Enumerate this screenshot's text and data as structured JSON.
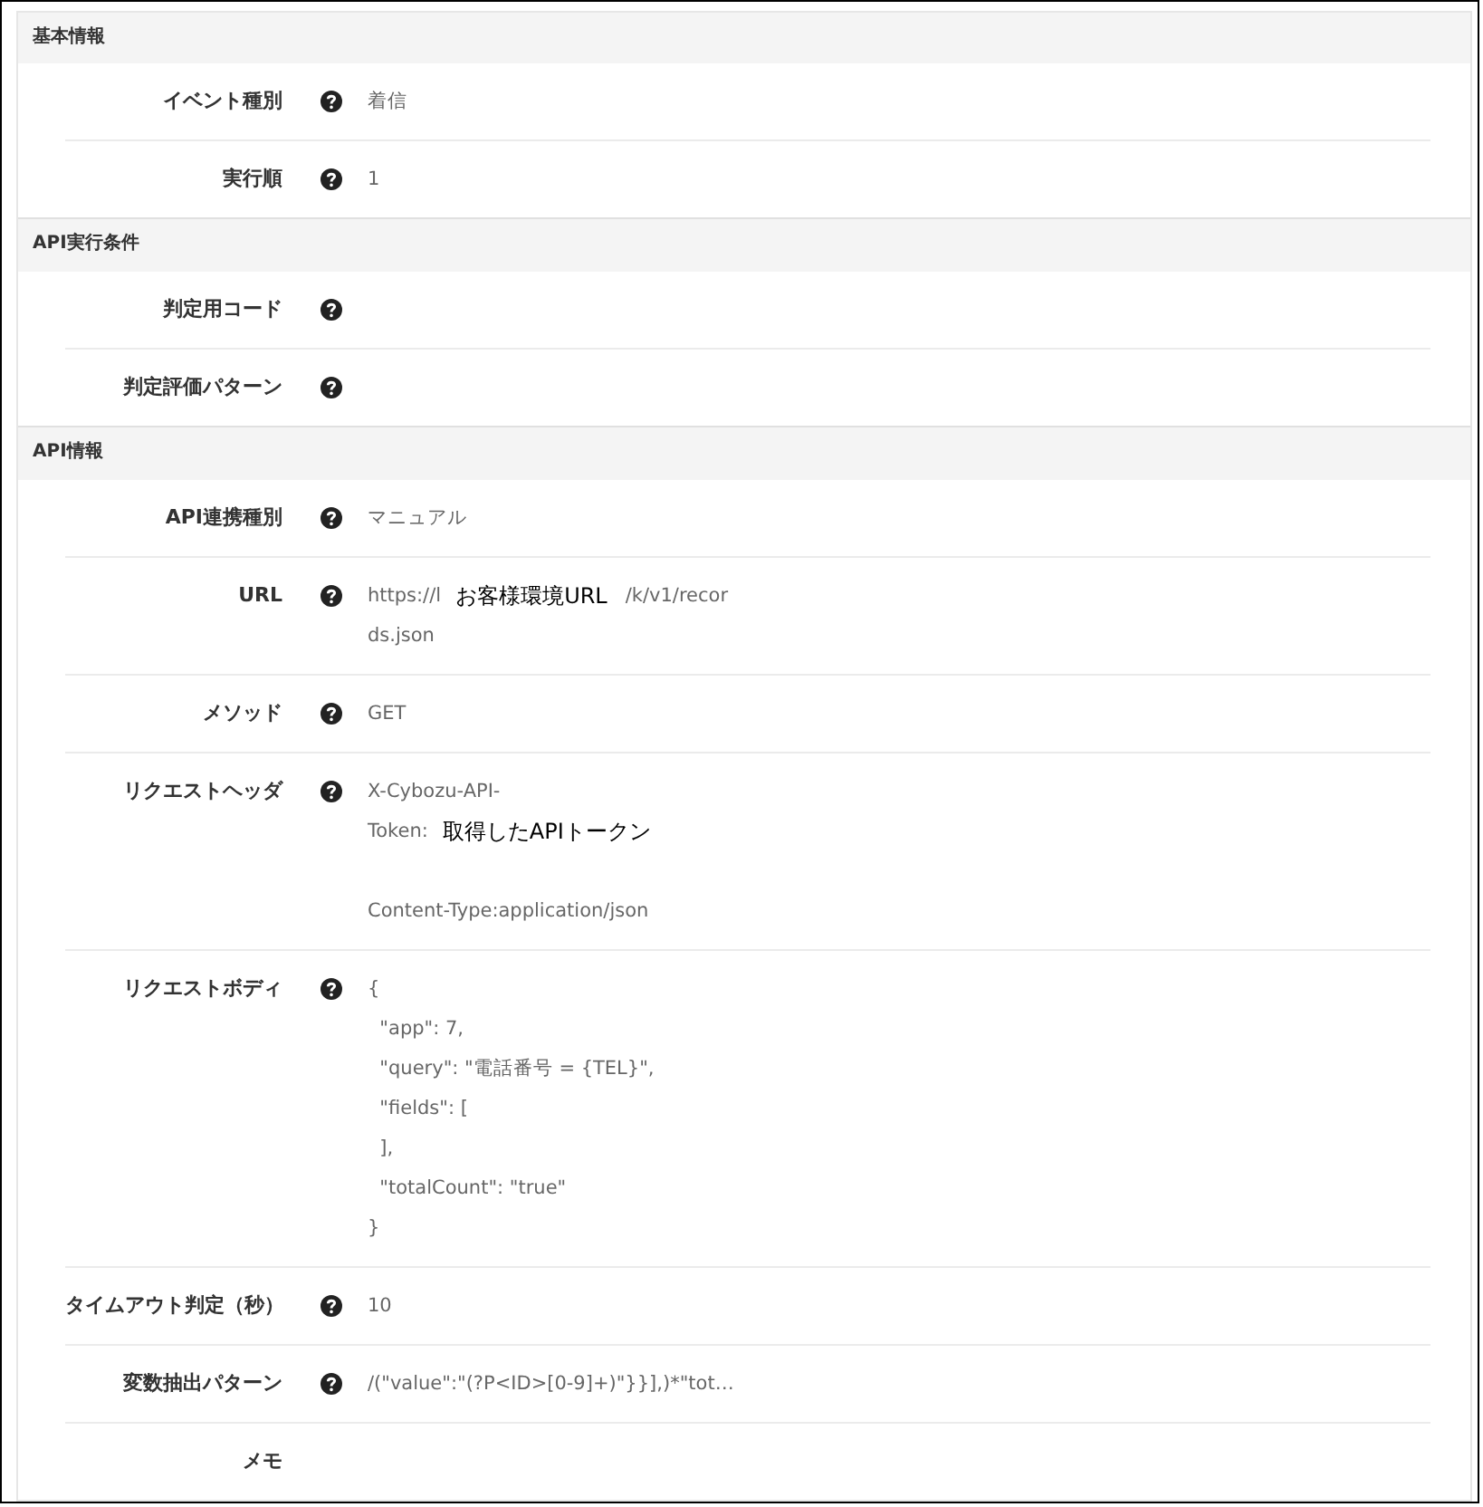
{
  "sections": [
    {
      "title": "基本情報",
      "fields": [
        {
          "label": "イベント種別",
          "help": true,
          "lines": [
            {
              "parts": [
                {
                  "kind": "text",
                  "text": "着信"
                }
              ]
            }
          ]
        },
        {
          "label": "実行順",
          "help": true,
          "lines": [
            {
              "parts": [
                {
                  "kind": "text",
                  "text": "1"
                }
              ]
            }
          ]
        }
      ]
    },
    {
      "title": "API実行条件",
      "fields": [
        {
          "label": "判定用コード",
          "help": true
        },
        {
          "label": "判定評価パターン",
          "help": true
        }
      ]
    },
    {
      "title": "API情報",
      "fields": [
        {
          "label": "API連携種別",
          "help": true,
          "lines": [
            {
              "parts": [
                {
                  "kind": "text",
                  "text": "マニュアル"
                }
              ]
            }
          ]
        },
        {
          "label": "URL",
          "help": true,
          "lines": [
            {
              "parts": [
                {
                  "kind": "text",
                  "text": "https://l"
                },
                {
                  "kind": "note",
                  "text": "お客様環境URL"
                },
                {
                  "kind": "text",
                  "text": "/k/v1/recor"
                }
              ]
            },
            {
              "parts": [
                {
                  "kind": "text",
                  "text": "ds.json"
                }
              ]
            }
          ]
        },
        {
          "label": "メソッド",
          "help": true,
          "lines": [
            {
              "parts": [
                {
                  "kind": "text",
                  "text": "GET"
                }
              ]
            }
          ]
        },
        {
          "label": "リクエストヘッダ",
          "help": true,
          "lines": [
            {
              "parts": [
                {
                  "kind": "text",
                  "text": "X-Cybozu-API-"
                }
              ]
            },
            {
              "parts": [
                {
                  "kind": "text",
                  "text": "Token:"
                },
                {
                  "kind": "note",
                  "text": "取得したAPIトークン"
                }
              ]
            },
            {
              "gap_before": true,
              "parts": [
                {
                  "kind": "text",
                  "text": "Content-Type:application/json"
                }
              ]
            }
          ]
        },
        {
          "label": "リクエストボディ",
          "help": true,
          "lines": [
            {
              "parts": [
                {
                  "kind": "text",
                  "text": "{"
                }
              ]
            },
            {
              "parts": [
                {
                  "kind": "text",
                  "text": "  \"app\": 7,"
                }
              ]
            },
            {
              "parts": [
                {
                  "kind": "text",
                  "text": "  \"query\": \"電話番号 = {TEL}\","
                }
              ]
            },
            {
              "parts": [
                {
                  "kind": "text",
                  "text": "  \"fields\": ["
                }
              ]
            },
            {
              "parts": [
                {
                  "kind": "text",
                  "text": "  ],"
                }
              ]
            },
            {
              "parts": [
                {
                  "kind": "text",
                  "text": "  \"totalCount\": \"true\""
                }
              ]
            },
            {
              "parts": [
                {
                  "kind": "text",
                  "text": "}"
                }
              ]
            }
          ]
        },
        {
          "label": "タイムアウト判定（秒）",
          "help": true,
          "lines": [
            {
              "parts": [
                {
                  "kind": "text",
                  "text": "10"
                }
              ]
            }
          ]
        },
        {
          "label": "変数抽出パターン",
          "help": true,
          "lines": [
            {
              "parts": [
                {
                  "kind": "text",
                  "text": "/(\"value\":\"(?P<ID>[0-9]+)\"}}],)*\"tot…"
                }
              ]
            }
          ]
        },
        {
          "label": "メモ",
          "help": false
        }
      ]
    }
  ]
}
